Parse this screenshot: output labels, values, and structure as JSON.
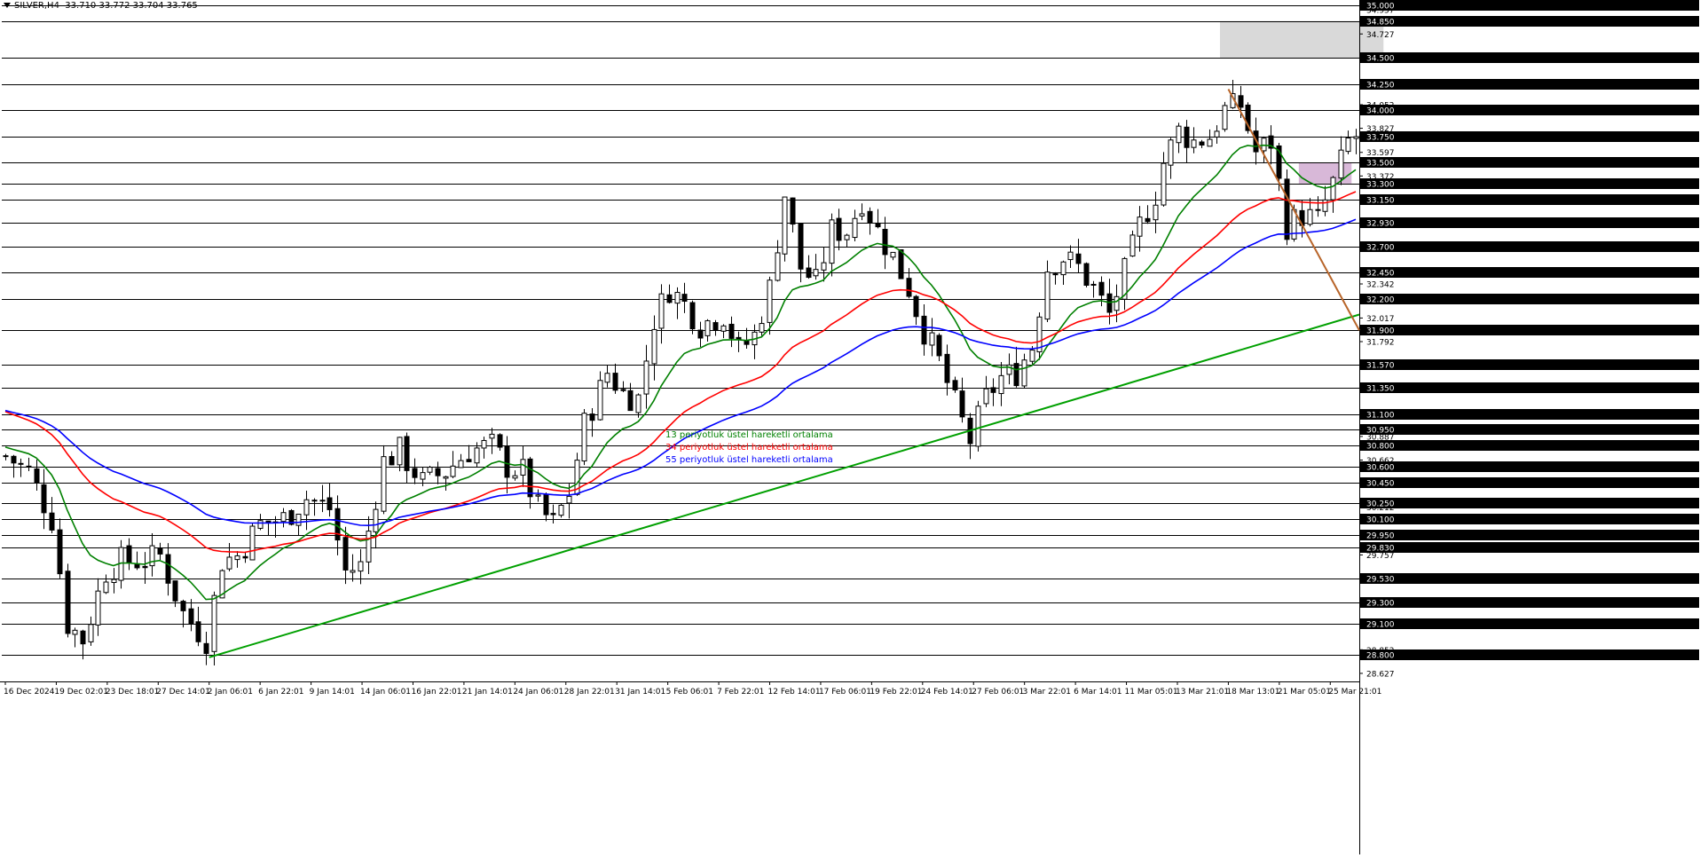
{
  "header": {
    "symbol": "SILVER,H4",
    "ohlc": "33.710 33.772 33.704 33.765"
  },
  "legend": [
    {
      "label": "13 periyotluk üstel hareketli ortalama",
      "color": "#008000"
    },
    {
      "label": "34 periyotluk üstel hareketli ortalama",
      "color": "#ff0000"
    },
    {
      "label": "55 periyotluk üstel hareketli ortalama",
      "color": "#0000ff"
    }
  ],
  "chart_data": {
    "type": "candlestick",
    "ylim": [
      28.55,
      35.0
    ],
    "level_lines": [
      35.0,
      34.85,
      34.5,
      34.25,
      34.0,
      33.75,
      33.5,
      33.3,
      33.15,
      32.93,
      32.7,
      32.45,
      32.2,
      31.9,
      31.57,
      31.35,
      31.1,
      30.95,
      30.8,
      30.6,
      30.45,
      30.25,
      30.1,
      29.95,
      29.83,
      29.53,
      29.3,
      29.1,
      28.8
    ],
    "level_labels": [
      "35.000",
      "34.850",
      "34.500",
      "34.250",
      "34.000",
      "33.750",
      "33.500",
      "33.300",
      "33.150",
      "32.930",
      "32.700",
      "32.450",
      "32.200",
      "31.900",
      "31.570",
      "31.350",
      "31.100",
      "30.950",
      "30.800",
      "30.600",
      "30.450",
      "30.250",
      "30.100",
      "29.950",
      "29.830",
      "29.530",
      "29.300",
      "29.100",
      "28.800"
    ],
    "scale_ticks": [
      34.957,
      34.727,
      34.052,
      33.827,
      33.597,
      33.372,
      32.342,
      32.017,
      31.792,
      30.887,
      30.662,
      30.212,
      29.757,
      29.082,
      28.852,
      28.627
    ],
    "scale_tick_labels": [
      "34.957",
      "34.727",
      "34.052",
      "33.827",
      "33.597",
      "33.372",
      "32.342",
      "32.017",
      "31.792",
      "30.887",
      "30.662",
      "30.212",
      "29.757",
      "29.082",
      "28.852",
      "28.627"
    ],
    "time_labels": [
      "16 Dec 2024",
      "19 Dec 02:01",
      "23 Dec 18:01",
      "27 Dec 14:01",
      "2 Jan 06:01",
      "6 Jan 22:01",
      "9 Jan 14:01",
      "14 Jan 06:01",
      "16 Jan 22:01",
      "21 Jan 14:01",
      "24 Jan 06:01",
      "28 Jan 22:01",
      "31 Jan 14:01",
      "5 Feb 06:01",
      "7 Feb 22:01",
      "12 Feb 14:01",
      "17 Feb 06:01",
      "19 Feb 22:01",
      "24 Feb 14:01",
      "27 Feb 06:01",
      "3 Mar 22:01",
      "6 Mar 14:01",
      "11 Mar 05:01",
      "13 Mar 21:01",
      "18 Mar 13:01",
      "21 Mar 05:01",
      "25 Mar 21:01"
    ],
    "zones": [
      {
        "from": "13 Mar 21:01",
        "to": "25 Mar 21:01",
        "y_from": 34.5,
        "y_to": 34.85,
        "color": "#d9d9d9"
      },
      {
        "from": "21 Mar 05:01",
        "to": "25 Mar 21:01",
        "y_from": 33.3,
        "y_to": 33.5,
        "color": "#d8b8d8"
      }
    ],
    "trendlines": [
      {
        "name": "support",
        "color": "#00a000",
        "from": {
          "t": "2 Jan 06:01",
          "y": 28.78
        },
        "to": {
          "t": "end",
          "y": 32.05
        }
      },
      {
        "name": "resistance",
        "color": "#b8652a",
        "from": {
          "t": "18 Mar 13:01",
          "y": 34.2
        },
        "to": {
          "t": "end",
          "y": 31.9
        }
      }
    ],
    "price_path": [
      [
        0,
        30.7
      ],
      [
        3,
        30.55
      ],
      [
        6,
        30.1
      ],
      [
        8,
        29.1
      ],
      [
        10,
        28.95
      ],
      [
        13,
        29.6
      ],
      [
        15,
        29.7
      ],
      [
        18,
        29.7
      ],
      [
        20,
        29.75
      ],
      [
        23,
        29.2
      ],
      [
        26,
        28.95
      ],
      [
        28,
        29.7
      ],
      [
        30,
        29.75
      ],
      [
        33,
        30.05
      ],
      [
        36,
        30.1
      ],
      [
        39,
        30.3
      ],
      [
        42,
        30.2
      ],
      [
        44,
        29.6
      ],
      [
        46,
        29.65
      ],
      [
        49,
        30.65
      ],
      [
        51,
        30.75
      ],
      [
        54,
        30.45
      ],
      [
        57,
        30.55
      ],
      [
        60,
        30.75
      ],
      [
        63,
        30.8
      ],
      [
        65,
        30.6
      ],
      [
        67,
        30.55
      ],
      [
        69,
        30.2
      ],
      [
        71,
        30.05
      ],
      [
        73,
        30.35
      ],
      [
        75,
        31.0
      ],
      [
        78,
        31.5
      ],
      [
        80,
        31.3
      ],
      [
        82,
        31.25
      ],
      [
        84,
        32.0
      ],
      [
        86,
        32.3
      ],
      [
        88,
        32.15
      ],
      [
        90,
        31.95
      ],
      [
        93,
        32.05
      ],
      [
        95,
        31.7
      ],
      [
        97,
        31.85
      ],
      [
        99,
        32.3
      ],
      [
        101,
        33.2
      ],
      [
        103,
        32.5
      ],
      [
        105,
        32.35
      ],
      [
        107,
        32.85
      ],
      [
        109,
        32.85
      ],
      [
        111,
        33.15
      ],
      [
        113,
        32.85
      ],
      [
        115,
        32.6
      ],
      [
        117,
        32.3
      ],
      [
        119,
        31.9
      ],
      [
        121,
        31.6
      ],
      [
        123,
        31.2
      ],
      [
        125,
        30.85
      ],
      [
        127,
        31.25
      ],
      [
        129,
        31.45
      ],
      [
        131,
        31.5
      ],
      [
        133,
        31.75
      ],
      [
        135,
        32.5
      ],
      [
        137,
        32.6
      ],
      [
        139,
        32.5
      ],
      [
        141,
        32.3
      ],
      [
        143,
        32.05
      ],
      [
        145,
        32.45
      ],
      [
        147,
        32.9
      ],
      [
        149,
        33.2
      ],
      [
        150,
        33.5
      ],
      [
        152,
        33.8
      ],
      [
        154,
        33.7
      ],
      [
        156,
        33.75
      ],
      [
        158,
        34.0
      ],
      [
        160,
        34.05
      ],
      [
        162,
        33.6
      ],
      [
        164,
        33.7
      ],
      [
        166,
        32.9
      ],
      [
        168,
        33.0
      ],
      [
        170,
        32.95
      ],
      [
        172,
        33.3
      ],
      [
        174,
        33.7
      ],
      [
        175,
        33.75
      ]
    ],
    "ema_periods": [
      13,
      34,
      55
    ],
    "ema_colors": [
      "#008000",
      "#ff0000",
      "#0000ff"
    ],
    "ema_start": [
      30.8,
      31.15,
      31.15
    ]
  }
}
